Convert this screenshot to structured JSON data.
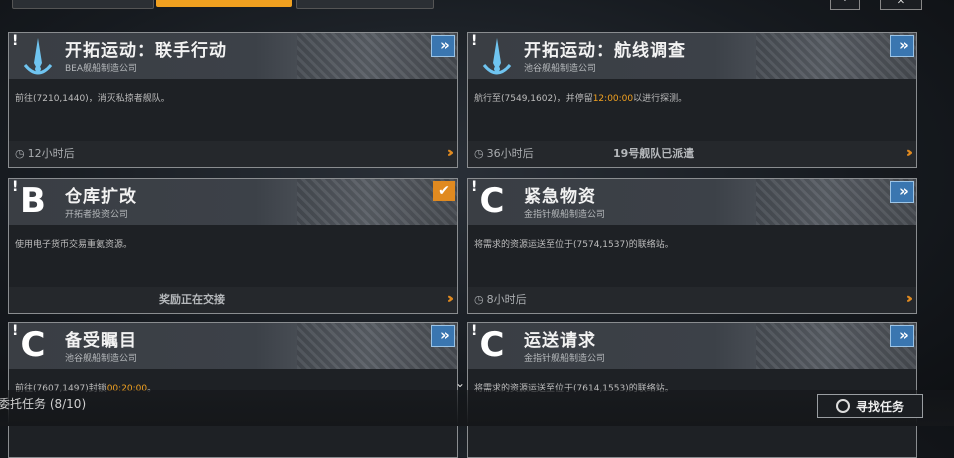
{
  "top_tabs": [
    {
      "label": ""
    },
    {
      "label": ""
    },
    {
      "label": ""
    }
  ],
  "missions": [
    {
      "title": "开拓运动：联手行动",
      "company": "BEA舰船制造公司",
      "desc_parts": [
        "前往(7210,1440)，消灭私掠者舰队。",
        "",
        ""
      ],
      "timer": "12小时后",
      "status": "",
      "grade": "",
      "icon": "fleet-icon",
      "action": "expand"
    },
    {
      "title": "开拓运动：航线调查",
      "company": "池谷舰船制造公司",
      "desc_parts": [
        "航行至(7549,1602)，并停留",
        "12:00:00",
        "以进行探测。"
      ],
      "timer": "36小时后",
      "status": "19号舰队已派遣",
      "grade": "",
      "icon": "fleet-icon",
      "action": "expand"
    },
    {
      "title": "仓库扩改",
      "company": "开拓者投资公司",
      "desc_parts": [
        "使用电子货币交易重氦资源。",
        "",
        ""
      ],
      "timer": "",
      "status": "奖励正在交接",
      "grade": "B",
      "icon": "",
      "action": "check"
    },
    {
      "title": "紧急物资",
      "company": "金指针舰船制造公司",
      "desc_parts": [
        "将需求的资源运送至位于(7574,1537)的联络站。",
        "",
        ""
      ],
      "timer": "8小时后",
      "status": "",
      "grade": "C",
      "icon": "",
      "action": "expand"
    },
    {
      "title": "备受瞩目",
      "company": "池谷舰船制造公司",
      "desc_parts": [
        "前往(7607,1497)封锁",
        "00:20:00",
        "。"
      ],
      "timer": "",
      "status": "",
      "grade": "C",
      "icon": "",
      "action": "expand"
    },
    {
      "title": "运送请求",
      "company": "金指针舰船制造公司",
      "desc_parts": [
        "将需求的资源运送至位于(7614,1553)的联络站。",
        "",
        ""
      ],
      "timer": "",
      "status": "",
      "grade": "C",
      "icon": "",
      "action": "expand"
    }
  ],
  "footer": {
    "count_label": "委托任务 (8/10)",
    "find_button": "寻找任务"
  },
  "colors": {
    "accent_orange": "#f0a020",
    "expand_blue": "#3a76b0",
    "card_bg": "#1e2125"
  }
}
